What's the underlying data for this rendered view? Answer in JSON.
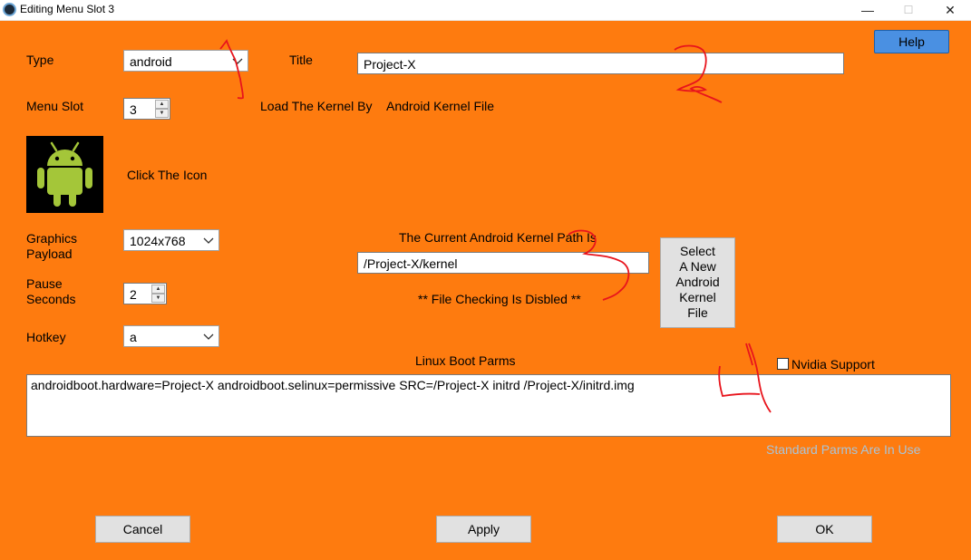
{
  "window": {
    "title": "Editing Menu Slot 3",
    "controls": {
      "minimize": "—",
      "maximize": "☐",
      "close": "✕"
    }
  },
  "colors": {
    "background": "#fe7b0f",
    "help_button": "#4a90e2",
    "annotation": "#e8141c",
    "hint_text": "#a9c4d8"
  },
  "form": {
    "type_label": "Type",
    "type_value": "android",
    "title_label": "Title",
    "title_value": "Project-X",
    "help_label": "Help",
    "menu_slot_label": "Menu Slot",
    "menu_slot_value": "3",
    "load_kernel_label": "Load The Kernel By",
    "load_kernel_value": "Android Kernel File",
    "icon_name": "android-icon",
    "click_icon_label": "Click The Icon",
    "graphics_label_1": "Graphics",
    "graphics_label_2": "Payload",
    "graphics_value": "1024x768",
    "pause_label_1": "Pause",
    "pause_label_2": "Seconds",
    "pause_value": "2",
    "hotkey_label": "Hotkey",
    "hotkey_value": "a",
    "kernel_path_label": "The Current Android Kernel Path Is",
    "kernel_path_value": "/Project-X/kernel",
    "file_check_label": "** File Checking Is Disbled **",
    "select_kernel_lines": [
      "Select",
      "A New",
      "Android",
      "Kernel",
      "File"
    ],
    "boot_parms_label": "Linux Boot Parms",
    "nvidia_label": "Nvidia Support",
    "nvidia_checked": false,
    "boot_parms_value": "androidboot.hardware=Project-X  androidboot.selinux=permissive SRC=/Project-X  initrd /Project-X/initrd.img",
    "standard_parms_label": "Standard Parms Are In Use"
  },
  "footer": {
    "cancel_label": "Cancel",
    "apply_label": "Apply",
    "ok_label": "OK"
  }
}
